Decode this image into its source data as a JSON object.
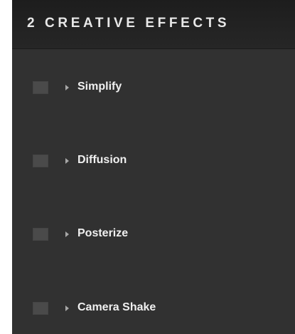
{
  "panel": {
    "title": "2 CREATIVE EFFECTS",
    "effects": [
      {
        "label": "Simplify",
        "checked": false,
        "expanded": false
      },
      {
        "label": "Diffusion",
        "checked": false,
        "expanded": false
      },
      {
        "label": "Posterize",
        "checked": false,
        "expanded": false
      },
      {
        "label": "Camera Shake",
        "checked": false,
        "expanded": false
      }
    ]
  },
  "colors": {
    "panel_background": "#313131",
    "header_background": "#1f1f1f",
    "text": "#f0f0f0",
    "checkbox": "#4a4a4a",
    "disclosure_triangle": "#a8a8a8"
  },
  "icons": {
    "disclosure": "triangle-right-icon"
  }
}
